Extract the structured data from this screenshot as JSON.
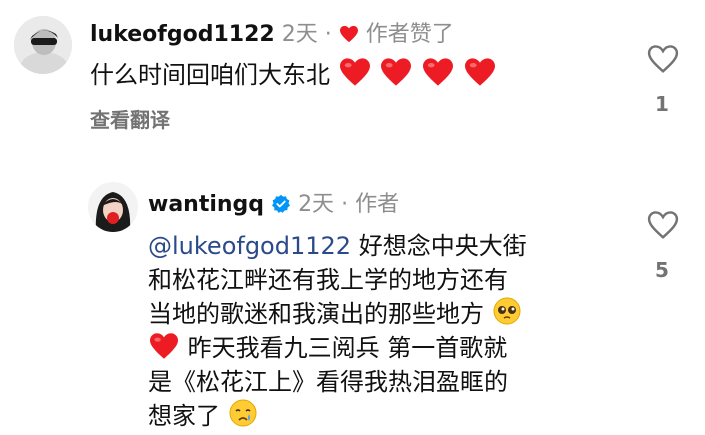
{
  "comment1": {
    "username": "lukeofgod1122",
    "time": "2天",
    "separator": "·",
    "liked_by_author": "作者赞了",
    "text": "什么时间回咱们大东北",
    "translate_link": "查看翻译",
    "like_count": "1"
  },
  "reply": {
    "username": "wantingq",
    "time": "2天",
    "separator": "·",
    "author_badge": "作者",
    "mention": "@lukeofgod1122",
    "line1_rest": " 好想念中央大街",
    "line2": "和松花江畔还有我上学的地方还有",
    "line3": "当地的歌迷和我演出的那些地方",
    "line4": " 昨天我看九三阅兵 第一首歌就",
    "line5": "是《松花江上》看得我热泪盈眶的",
    "line6": "想家了",
    "like_count": "5"
  },
  "colors": {
    "heart_red": "#ed1c24",
    "verified_blue": "#0095f6",
    "meta_gray": "#8e8e8e"
  }
}
